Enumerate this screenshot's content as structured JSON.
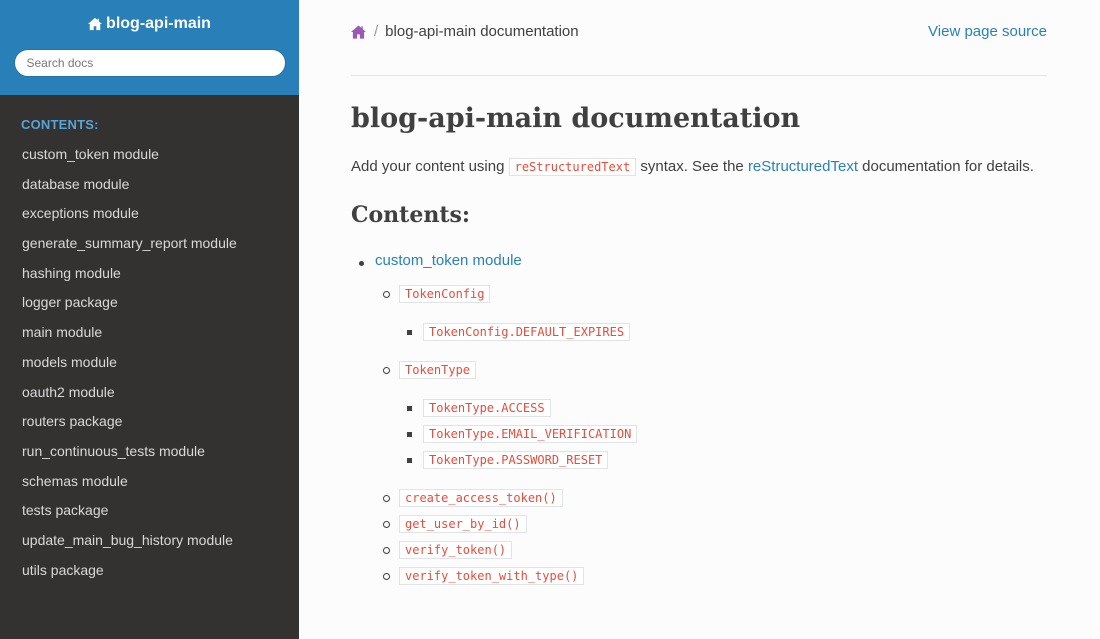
{
  "sidebar": {
    "brand": "blog-api-main",
    "search_placeholder": "Search docs",
    "caption": "CONTENTS:",
    "items": [
      "custom_token module",
      "database module",
      "exceptions module",
      "generate_summary_report module",
      "hashing module",
      "logger package",
      "main module",
      "models module",
      "oauth2 module",
      "routers package",
      "run_continuous_tests module",
      "schemas module",
      "tests package",
      "update_main_bug_history module",
      "utils package"
    ]
  },
  "breadcrumb": {
    "home_icon": "home-icon",
    "separator": "/",
    "current": "blog-api-main documentation",
    "view_source": "View page source"
  },
  "main": {
    "title": "blog-api-main documentation",
    "intro_before": "Add your content using ",
    "intro_code": "reStructuredText",
    "intro_mid": " syntax. See the ",
    "intro_link": "reStructuredText",
    "intro_after": " documentation for details.",
    "contents_heading": "Contents:",
    "toc": {
      "module": "custom_token module",
      "token_config": "TokenConfig",
      "token_config_default": "TokenConfig.DEFAULT_EXPIRES",
      "token_type": "TokenType",
      "token_type_access": "TokenType.ACCESS",
      "token_type_email": "TokenType.EMAIL_VERIFICATION",
      "token_type_password": "TokenType.PASSWORD_RESET",
      "create_access_token": "create_access_token()",
      "get_user_by_id": "get_user_by_id()",
      "verify_token": "verify_token()",
      "verify_token_with_type": "verify_token_with_type()"
    }
  },
  "colors": {
    "sidebar_header": "#2980b9",
    "sidebar_bg": "#343131",
    "link": "#2980b9",
    "code_text": "#e74c3c",
    "home_icon": "#9b59b6"
  }
}
